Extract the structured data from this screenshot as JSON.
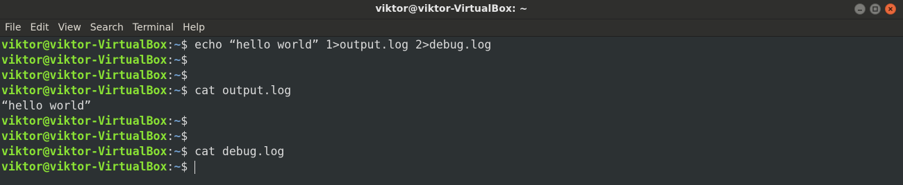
{
  "window": {
    "title": "viktor@viktor-VirtualBox: ~"
  },
  "menubar": {
    "items": [
      {
        "label": "File"
      },
      {
        "label": "Edit"
      },
      {
        "label": "View"
      },
      {
        "label": "Search"
      },
      {
        "label": "Terminal"
      },
      {
        "label": "Help"
      }
    ]
  },
  "prompt": {
    "user_host": "viktor@viktor-VirtualBox",
    "separator": ":",
    "path": "~",
    "symbol": "$"
  },
  "terminal": {
    "lines": [
      {
        "type": "prompt",
        "command": " echo “hello world” 1>output.log 2>debug.log"
      },
      {
        "type": "prompt",
        "command": ""
      },
      {
        "type": "prompt",
        "command": ""
      },
      {
        "type": "prompt",
        "command": " cat output.log"
      },
      {
        "type": "output",
        "text": "“hello world”"
      },
      {
        "type": "prompt",
        "command": ""
      },
      {
        "type": "prompt",
        "command": ""
      },
      {
        "type": "prompt",
        "command": " cat debug.log"
      },
      {
        "type": "prompt",
        "command": ""
      }
    ]
  },
  "colors": {
    "prompt_user": "#8ae234",
    "prompt_path": "#729fcf",
    "background": "#2c3133",
    "close_button": "#e9683b"
  },
  "icons": {
    "minimize": "minimize-icon",
    "maximize": "maximize-icon",
    "close": "close-icon"
  }
}
